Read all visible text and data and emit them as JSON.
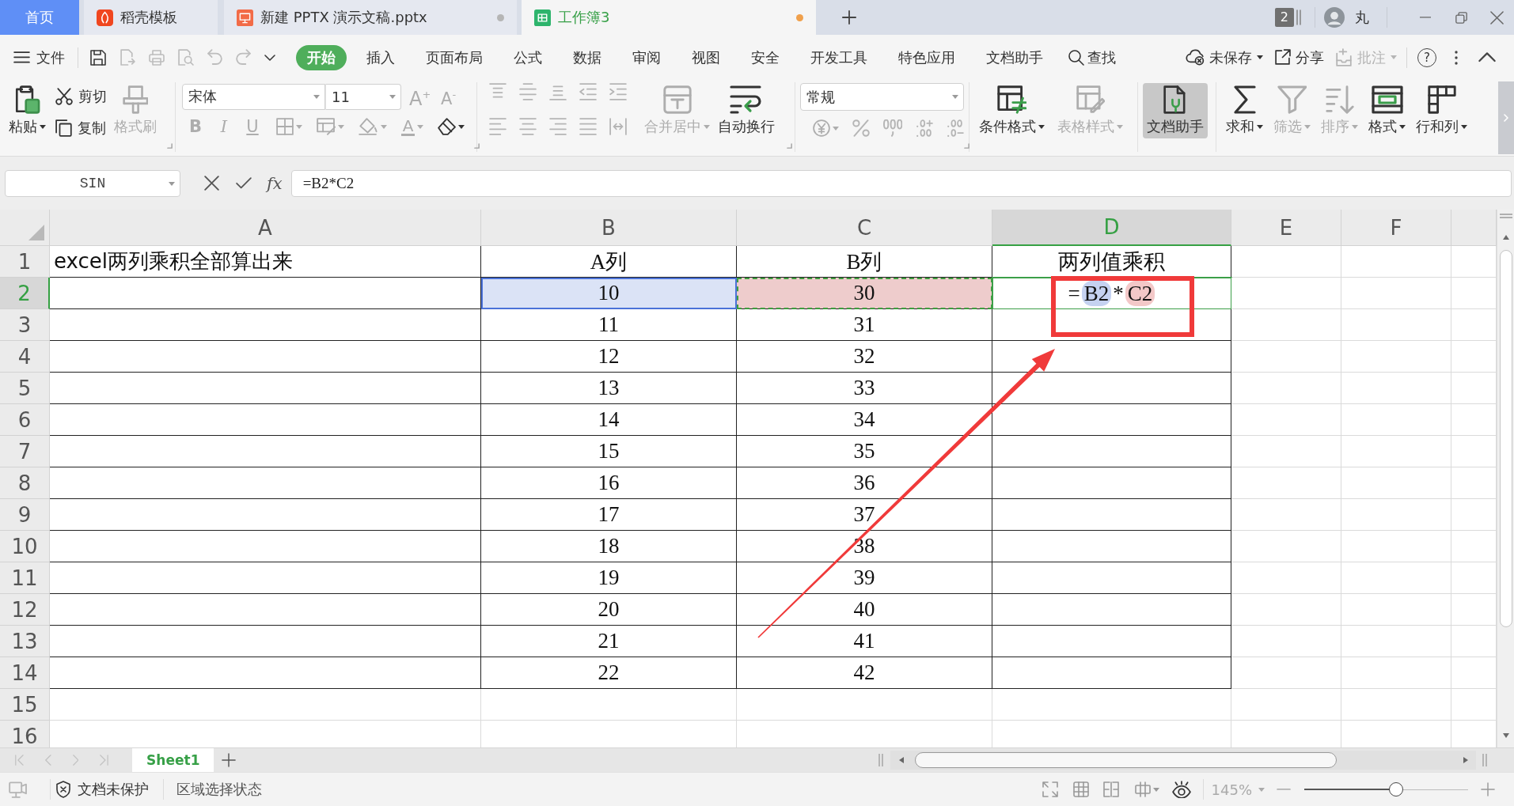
{
  "tabs": [
    {
      "kind": "home",
      "label": "首页",
      "selected": false,
      "unsaved": false
    },
    {
      "kind": "docer",
      "label": "稻壳模板",
      "selected": false,
      "unsaved": false
    },
    {
      "kind": "presentation",
      "label": "新建 PPTX 演示文稿.pptx",
      "selected": false,
      "unsaved": true
    },
    {
      "kind": "spreadsheet",
      "label": "工作簿3",
      "selected": true,
      "unsaved": true
    }
  ],
  "title_bar": {
    "window_count": "2",
    "user_name": "丸"
  },
  "menu_bar": {
    "file_label": "文件",
    "quick_access": [
      {
        "kind": "save",
        "disabled": false
      },
      {
        "kind": "export",
        "disabled": true
      },
      {
        "kind": "print",
        "disabled": true
      },
      {
        "kind": "preview",
        "disabled": true
      },
      {
        "kind": "undo",
        "disabled": true
      },
      {
        "kind": "redo",
        "disabled": true
      },
      {
        "kind": "more",
        "disabled": false
      }
    ],
    "tabs": [
      {
        "label": "开始",
        "selected": true
      },
      {
        "label": "插入",
        "selected": false
      },
      {
        "label": "页面布局",
        "selected": false
      },
      {
        "label": "公式",
        "selected": false
      },
      {
        "label": "数据",
        "selected": false
      },
      {
        "label": "审阅",
        "selected": false
      },
      {
        "label": "视图",
        "selected": false
      },
      {
        "label": "安全",
        "selected": false
      },
      {
        "label": "开发工具",
        "selected": false
      },
      {
        "label": "特色应用",
        "selected": false
      },
      {
        "label": "文档助手",
        "selected": false
      }
    ],
    "search_label": "查找",
    "actions": [
      {
        "kind": "cloud",
        "label": "未保存",
        "dropdown": true,
        "disabled": false
      },
      {
        "kind": "share",
        "label": "分享",
        "dropdown": false,
        "disabled": false
      },
      {
        "kind": "comment",
        "label": "批注",
        "dropdown": true,
        "disabled": true
      }
    ],
    "help_label": "?"
  },
  "ribbon": {
    "clipboard": [
      {
        "kind": "paste",
        "label": "粘贴",
        "dropdown": true,
        "disabled": false
      },
      {
        "kind": "cut",
        "label": "剪切",
        "disabled": false
      },
      {
        "kind": "copy",
        "label": "复制",
        "disabled": false
      },
      {
        "kind": "format_painter",
        "label": "格式刷",
        "disabled": true
      }
    ],
    "font": {
      "name": "宋体",
      "size": "11",
      "size_buttons": [
        {
          "kind": "grow",
          "label": "A$^{+}$",
          "disabled": true
        },
        {
          "kind": "shrink",
          "label": "A$^{-}$",
          "disabled": true
        }
      ],
      "styles": [
        {
          "kind": "bold",
          "label": "B",
          "disabled": true
        },
        {
          "kind": "italic",
          "label": "I",
          "disabled": true
        },
        {
          "kind": "underline",
          "label": "U",
          "disabled": true
        }
      ],
      "tools": [
        {
          "kind": "borders",
          "dropdown": true,
          "disabled": true
        },
        {
          "kind": "cell_format",
          "dropdown": true,
          "disabled": true
        },
        {
          "kind": "fill",
          "dropdown": true,
          "disabled": true
        },
        {
          "kind": "font_color",
          "label": "A",
          "dropdown": true,
          "disabled": true
        },
        {
          "kind": "clear",
          "dropdown": true,
          "disabled": false
        }
      ]
    },
    "alignment": {
      "icons": [
        {
          "kind": "top",
          "disabled": true
        },
        {
          "kind": "middle",
          "disabled": true
        },
        {
          "kind": "bottom",
          "disabled": true
        },
        {
          "kind": "outdent",
          "disabled": true
        },
        {
          "kind": "indent",
          "disabled": true
        },
        {
          "kind": "left",
          "disabled": true
        },
        {
          "kind": "center",
          "disabled": true
        },
        {
          "kind": "right",
          "disabled": true
        },
        {
          "kind": "justify",
          "disabled": true
        },
        {
          "kind": "distributed",
          "disabled": true
        }
      ],
      "buttons": [
        {
          "kind": "merge",
          "label": "合并居中",
          "dropdown": true,
          "disabled": true
        },
        {
          "kind": "wrap",
          "label": "自动换行",
          "dropdown": false,
          "disabled": false
        }
      ]
    },
    "number": {
      "format": "常规",
      "tools": [
        {
          "kind": "currency",
          "dropdown": true,
          "disabled": true
        },
        {
          "kind": "percent",
          "dropdown": false,
          "disabled": true
        },
        {
          "kind": "thousands",
          "dropdown": false,
          "disabled": true
        },
        {
          "kind": "increase_decimal",
          "dropdown": false,
          "disabled": true
        },
        {
          "kind": "decrease_decimal",
          "dropdown": false,
          "disabled": true
        }
      ]
    },
    "styles": [
      {
        "kind": "conditional",
        "label": "条件格式",
        "dropdown": true,
        "disabled": false
      },
      {
        "kind": "table_style",
        "label": "表格样式",
        "dropdown": true,
        "disabled": true
      }
    ],
    "assistant": {
      "kind": "assistant",
      "label": "文档助手",
      "dropdown": false,
      "disabled": false,
      "selected": true
    },
    "editing": [
      {
        "kind": "sum",
        "label": "求和",
        "dropdown": true,
        "disabled": false
      },
      {
        "kind": "filter",
        "label": "筛选",
        "dropdown": true,
        "disabled": true
      },
      {
        "kind": "sort",
        "label": "排序",
        "dropdown": true,
        "disabled": true
      },
      {
        "kind": "format",
        "label": "格式",
        "dropdown": true,
        "disabled": false
      },
      {
        "kind": "rows_columns",
        "label": "行和列",
        "dropdown": true,
        "disabled": false
      }
    ]
  },
  "formula_bar": {
    "name_box": "SIN",
    "fx_label": "fx",
    "formula": "=B2*C2"
  },
  "sheet": {
    "columns": [
      {
        "label": "A",
        "selected": false
      },
      {
        "label": "B",
        "selected": false
      },
      {
        "label": "C",
        "selected": false
      },
      {
        "label": "D",
        "selected": true
      },
      {
        "label": "E",
        "selected": false
      },
      {
        "label": "F",
        "selected": false
      }
    ],
    "rows": [
      {
        "label": "1",
        "selected": false,
        "bordered": true,
        "cells": [
          {
            "kind": "title",
            "text": "excel两列乘积全部算出来"
          },
          {
            "kind": "value",
            "text": "A列"
          },
          {
            "kind": "value",
            "text": "B列"
          },
          {
            "kind": "value",
            "text": "两列值乘积"
          }
        ]
      },
      {
        "label": "2",
        "selected": true,
        "bordered": true,
        "cells": [
          null,
          {
            "kind": "value",
            "text": "10",
            "color": "#dbe3f6",
            "dashed": false
          },
          {
            "kind": "value",
            "text": "30",
            "color": "#eecccc",
            "dashed": true
          },
          {
            "kind": "formula",
            "active": true,
            "parts": [
              {
                "kind": "operator",
                "text": "="
              },
              {
                "kind": "reference",
                "text": "B2",
                "color": "#c5d2f1"
              },
              {
                "kind": "operator",
                "text": "*"
              },
              {
                "kind": "reference",
                "text": "C2",
                "color": "#f3c8c8"
              }
            ]
          }
        ]
      },
      {
        "label": "3",
        "selected": false,
        "bordered": true,
        "cells": [
          null,
          {
            "kind": "value",
            "text": "11"
          },
          {
            "kind": "value",
            "text": "31"
          }
        ]
      },
      {
        "label": "4",
        "selected": false,
        "bordered": true,
        "cells": [
          null,
          {
            "kind": "value",
            "text": "12"
          },
          {
            "kind": "value",
            "text": "32"
          }
        ]
      },
      {
        "label": "5",
        "selected": false,
        "bordered": true,
        "cells": [
          null,
          {
            "kind": "value",
            "text": "13"
          },
          {
            "kind": "value",
            "text": "33"
          }
        ]
      },
      {
        "label": "6",
        "selected": false,
        "bordered": true,
        "cells": [
          null,
          {
            "kind": "value",
            "text": "14"
          },
          {
            "kind": "value",
            "text": "34"
          }
        ]
      },
      {
        "label": "7",
        "selected": false,
        "bordered": true,
        "cells": [
          null,
          {
            "kind": "value",
            "text": "15"
          },
          {
            "kind": "value",
            "text": "35"
          }
        ]
      },
      {
        "label": "8",
        "selected": false,
        "bordered": true,
        "cells": [
          null,
          {
            "kind": "value",
            "text": "16"
          },
          {
            "kind": "value",
            "text": "36"
          }
        ]
      },
      {
        "label": "9",
        "selected": false,
        "bordered": true,
        "cells": [
          null,
          {
            "kind": "value",
            "text": "17"
          },
          {
            "kind": "value",
            "text": "37"
          }
        ]
      },
      {
        "label": "10",
        "selected": false,
        "bordered": true,
        "cells": [
          null,
          {
            "kind": "value",
            "text": "18"
          },
          {
            "kind": "value",
            "text": "38"
          }
        ]
      },
      {
        "label": "11",
        "selected": false,
        "bordered": true,
        "cells": [
          null,
          {
            "kind": "value",
            "text": "19"
          },
          {
            "kind": "value",
            "text": "39"
          }
        ]
      },
      {
        "label": "12",
        "selected": false,
        "bordered": true,
        "cells": [
          null,
          {
            "kind": "value",
            "text": "20"
          },
          {
            "kind": "value",
            "text": "40"
          }
        ]
      },
      {
        "label": "13",
        "selected": false,
        "bordered": true,
        "cells": [
          null,
          {
            "kind": "value",
            "text": "21"
          },
          {
            "kind": "value",
            "text": "41"
          }
        ]
      },
      {
        "label": "14",
        "selected": false,
        "bordered": true,
        "cells": [
          null,
          {
            "kind": "value",
            "text": "22"
          },
          {
            "kind": "value",
            "text": "42"
          }
        ]
      },
      {
        "label": "15",
        "selected": false,
        "bordered": false
      },
      {
        "label": "16",
        "selected": false,
        "bordered": false
      }
    ]
  },
  "sheet_tabs": [
    {
      "label": "Sheet1",
      "selected": true
    }
  ],
  "status_bar": {
    "protection": "文档未保护",
    "mode": "区域选择状态",
    "zoom": "145%",
    "zoom_slider": {
      "level": 0.56
    }
  }
}
